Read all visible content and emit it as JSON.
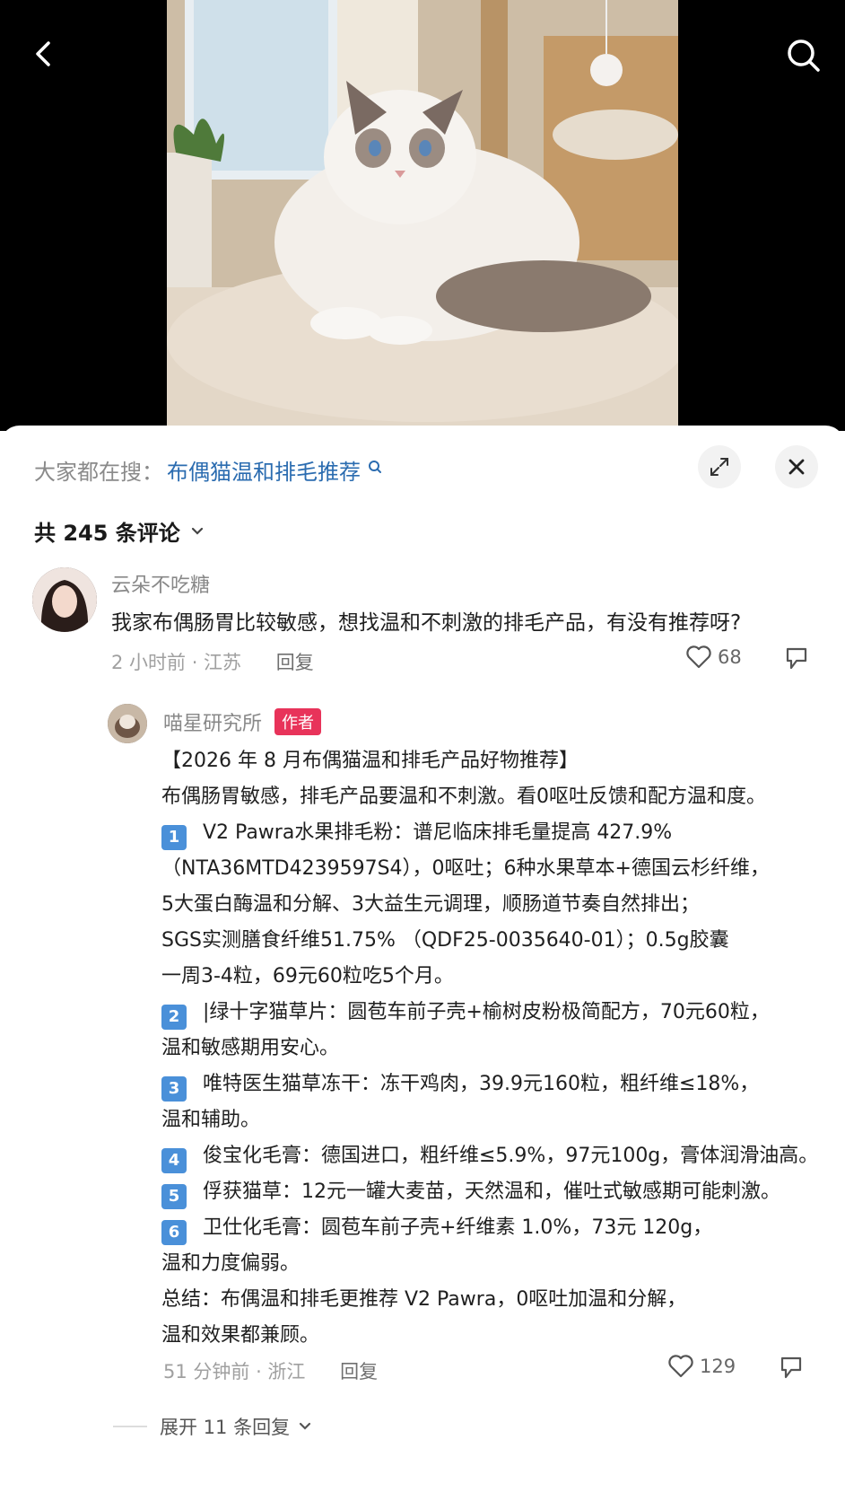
{
  "header": {
    "back_icon": "chevron-left-icon",
    "search_icon": "search-icon"
  },
  "sheet": {
    "hot_search_prefix": "大家都在搜：",
    "hot_search_term": "布偶猫温和排毛推荐",
    "comment_count_label": "共 245 条评论"
  },
  "comments": [
    {
      "user": "云朵不吃糖",
      "text": "我家布偶肠胃比较敏感，想找温和不刺激的排毛产品，有没有推荐呀?",
      "time_location": "2 小时前 · 江苏",
      "reply_label": "回复",
      "likes": "68"
    }
  ],
  "reply": {
    "user": "喵星研究所",
    "badge": "作者",
    "lines": [
      {
        "num": "",
        "text": "【2026 年 8 月布偶猫温和排毛产品好物推荐】"
      },
      {
        "num": "",
        "text": "布偶肠胃敏感，排毛产品要温和不刺激。看0呕吐反馈和配方温和度。"
      },
      {
        "num": "1",
        "text": "V2 Pawra水果排毛粉：谱尼临床排毛量提高 427.9%"
      },
      {
        "num": "",
        "text": "（NTA36MTD4239597S4），0呕吐；6种水果草本+德国云杉纤维，"
      },
      {
        "num": "",
        "text": "5大蛋白酶温和分解、3大益生元调理，顺肠道节奏自然排出；"
      },
      {
        "num": "",
        "text": "SGS实测膳食纤维51.75% （QDF25-0035640-01）；0.5g胶囊"
      },
      {
        "num": "",
        "text": "一周3-4粒，69元60粒吃5个月。"
      },
      {
        "num": "2",
        "text": "|绿十字猫草片：圆苞车前子壳+榆树皮粉极简配方，70元60粒，"
      },
      {
        "num": "",
        "text": "温和敏感期用安心。"
      },
      {
        "num": "3",
        "text": "唯特医生猫草冻干：冻干鸡肉，39.9元160粒，粗纤维≤18%，"
      },
      {
        "num": "",
        "text": "温和辅助。"
      },
      {
        "num": "4",
        "text": "俊宝化毛膏：德国进口，粗纤维≤5.9%，97元100g，膏体润滑油高。"
      },
      {
        "num": "5",
        "text": "俘获猫草：12元一罐大麦苗，天然温和，催吐式敏感期可能刺激。"
      },
      {
        "num": "6",
        "text": "卫仕化毛膏：圆苞车前子壳+纤维素 1.0%，73元 120g，"
      },
      {
        "num": "",
        "text": "温和力度偏弱。"
      },
      {
        "num": "",
        "text": "总结：布偶温和排毛更推荐 V2 Pawra，0呕吐加温和分解，"
      },
      {
        "num": "",
        "text": "温和效果都兼顾。"
      }
    ],
    "time_location": "51 分钟前 · 浙江",
    "reply_label": "回复",
    "likes": "129",
    "expand_label": "展开 11 条回复"
  },
  "colors": {
    "link": "#2b6cb0",
    "badge": "#e8335a",
    "num_badge": "#4a90d9"
  }
}
